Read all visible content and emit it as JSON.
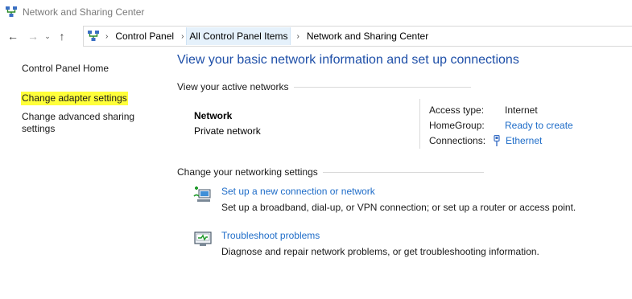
{
  "window": {
    "title": "Network and Sharing Center"
  },
  "address_bar": {
    "breadcrumbs": [
      "Control Panel",
      "All Control Panel Items",
      "Network and Sharing Center"
    ]
  },
  "left_pane": {
    "links": [
      "Control Panel Home",
      "Change adapter settings",
      "Change advanced sharing settings"
    ],
    "highlight_color": "#ffff3a"
  },
  "main": {
    "title": "View your basic network information and set up connections",
    "active_networks_header": "View your active networks",
    "network": {
      "name": "Network",
      "type": "Private network",
      "access_type_label": "Access type:",
      "access_type_value": "Internet",
      "homegroup_label": "HomeGroup:",
      "homegroup_value": "Ready to create",
      "connections_label": "Connections:",
      "connections_value": "Ethernet"
    },
    "change_settings_header": "Change your networking settings",
    "tasks": [
      {
        "link": "Set up a new connection or network",
        "description": "Set up a broadband, dial-up, or VPN connection; or set up a router or access point.",
        "icon": "new-connection-icon"
      },
      {
        "link": "Troubleshoot problems",
        "description": "Diagnose and repair network problems, or get troubleshooting information.",
        "icon": "troubleshoot-icon"
      }
    ]
  },
  "colors": {
    "title_blue": "#1e4fa8",
    "link_blue": "#1e6cc8"
  }
}
